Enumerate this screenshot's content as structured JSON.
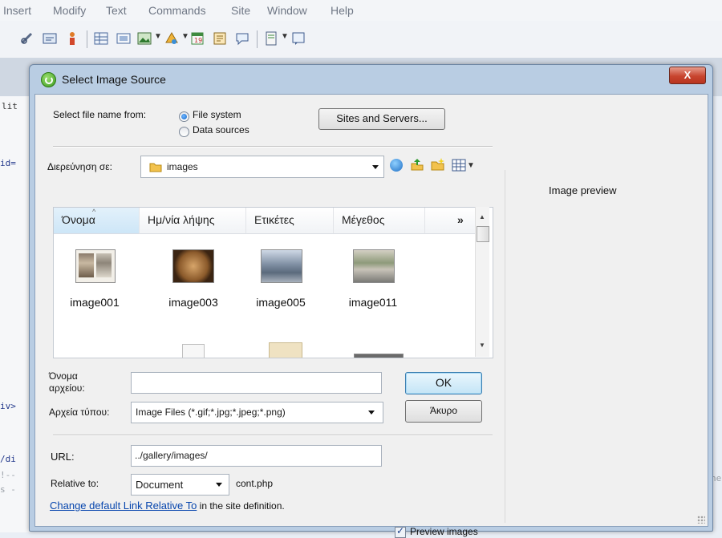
{
  "app": {
    "menu": [
      "Insert",
      "Modify",
      "Text",
      "Commands",
      "Site",
      "Window",
      "Help"
    ],
    "code_lines": [
      "lit",
      "id=",
      "iv>",
      "/di",
      "!--",
      "s -",
      "ne"
    ]
  },
  "dialog": {
    "title": "Select Image Source",
    "close_label": "X",
    "select_from_label": "Select file name from:",
    "source_options": [
      "File system",
      "Data sources"
    ],
    "selected_source": "File system",
    "sites_button": "Sites and Servers...",
    "look_in_label": "Διερεύνηση σε:",
    "look_in_value": "images",
    "columns": [
      "Όνομα",
      "Ημ/νία λήψης",
      "Ετικέτες",
      "Μέγεθος",
      "»"
    ],
    "files": [
      "image001",
      "image003",
      "image005",
      "image011"
    ],
    "filename_label": "Όνομα αρχείου:",
    "filename_value": "",
    "filetype_label": "Αρχεία τύπου:",
    "filetype_value": "Image Files (*.gif;*.jpg;*.jpeg;*.png)",
    "ok_button": "OK",
    "cancel_button": "Άκυρο",
    "url_label": "URL:",
    "url_value": "../gallery/images/",
    "relative_label": "Relative to:",
    "relative_value": "Document",
    "relative_file": "cont.php",
    "change_link": "Change default Link Relative To",
    "change_link_suffix": " in the site definition.",
    "preview_label": "Image preview",
    "preview_images_label": "Preview images",
    "preview_images_checked": true
  }
}
